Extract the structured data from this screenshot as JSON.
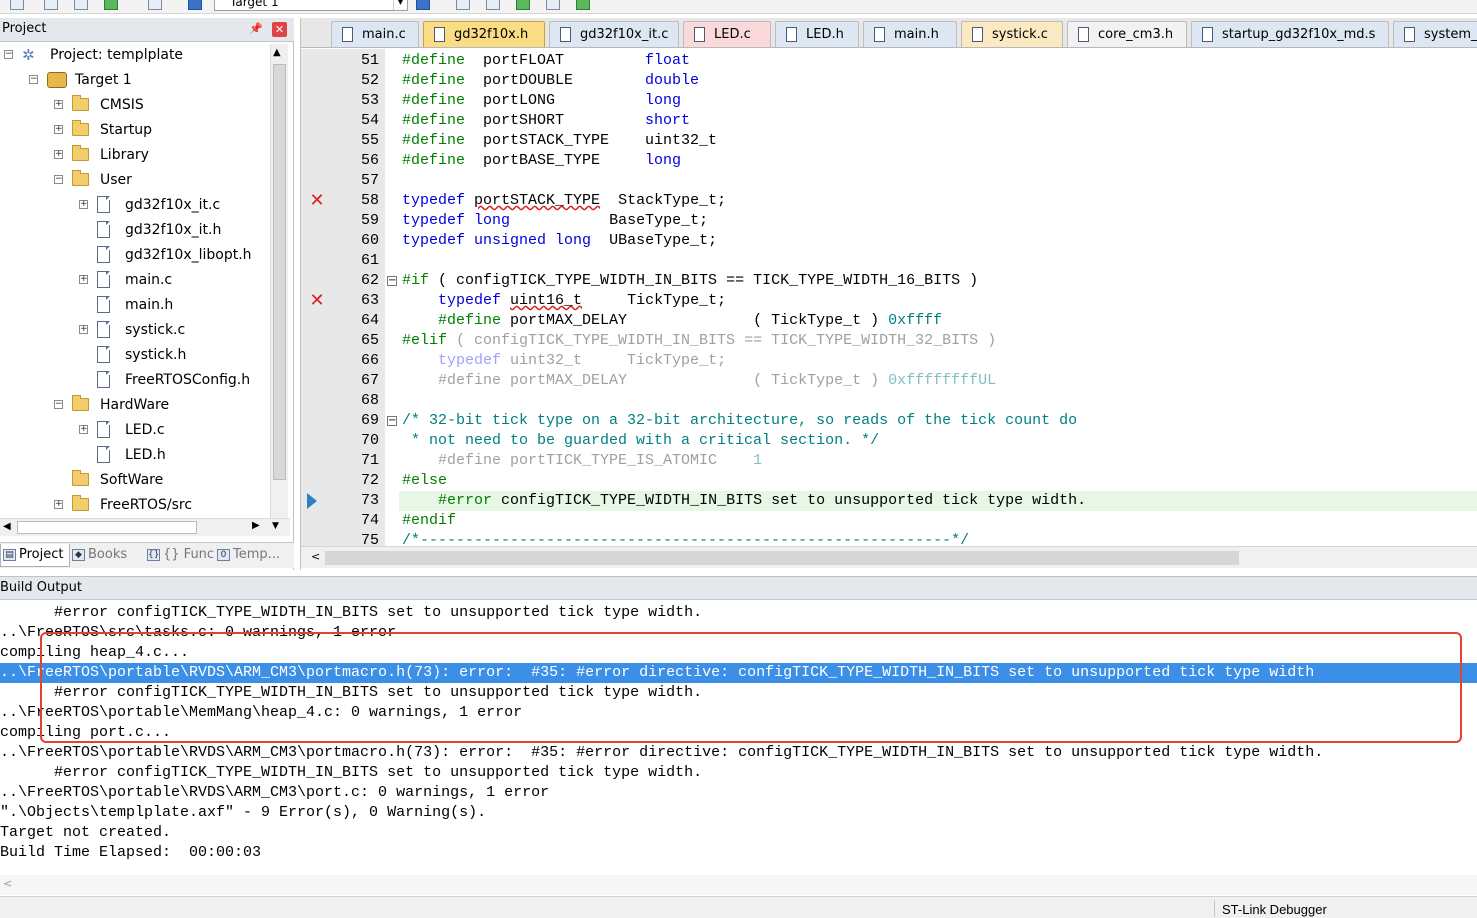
{
  "toolbar": {
    "target_value": "Target 1",
    "icons": [
      "build-icon",
      "rebuild-icon",
      "batch-build-icon",
      "translate-icon",
      "download-icon",
      "options-icon",
      "manage-icon",
      "debug-icon",
      "load-icon",
      "pack-icon"
    ]
  },
  "project_panel": {
    "title": "Project",
    "tree": [
      {
        "label": "Project: templplate",
        "kind": "project",
        "level": 0,
        "expander": "−"
      },
      {
        "label": "Target 1",
        "kind": "target",
        "level": 1,
        "expander": "−"
      },
      {
        "label": "CMSIS",
        "kind": "folder",
        "level": 2,
        "expander": "+"
      },
      {
        "label": "Startup",
        "kind": "folder",
        "level": 2,
        "expander": "+"
      },
      {
        "label": "Library",
        "kind": "folder",
        "level": 2,
        "expander": "+"
      },
      {
        "label": "User",
        "kind": "folder",
        "level": 2,
        "expander": "−"
      },
      {
        "label": "gd32f10x_it.c",
        "kind": "file",
        "level": 3,
        "expander": "+"
      },
      {
        "label": "gd32f10x_it.h",
        "kind": "file",
        "level": 3,
        "expander": ""
      },
      {
        "label": "gd32f10x_libopt.h",
        "kind": "file",
        "level": 3,
        "expander": ""
      },
      {
        "label": "main.c",
        "kind": "file",
        "level": 3,
        "expander": "+"
      },
      {
        "label": "main.h",
        "kind": "file",
        "level": 3,
        "expander": ""
      },
      {
        "label": "systick.c",
        "kind": "file",
        "level": 3,
        "expander": "+"
      },
      {
        "label": "systick.h",
        "kind": "file",
        "level": 3,
        "expander": ""
      },
      {
        "label": "FreeRTOSConfig.h",
        "kind": "file",
        "level": 3,
        "expander": ""
      },
      {
        "label": "HardWare",
        "kind": "folder",
        "level": 2,
        "expander": "−"
      },
      {
        "label": "LED.c",
        "kind": "file",
        "level": 3,
        "expander": "+"
      },
      {
        "label": "LED.h",
        "kind": "file",
        "level": 3,
        "expander": ""
      },
      {
        "label": "SoftWare",
        "kind": "folder",
        "level": 2,
        "expander": ""
      },
      {
        "label": "FreeRTOS/src",
        "kind": "folder",
        "level": 2,
        "expander": "+"
      }
    ],
    "bottom_tabs": [
      {
        "label": "Project",
        "icon": "project-icon",
        "active": true
      },
      {
        "label": "Books",
        "icon": "books-icon",
        "active": false
      },
      {
        "label": "{} Func...",
        "icon": "functions-icon",
        "active": false
      },
      {
        "label": "Temp...",
        "icon": "templates-icon",
        "active": false
      }
    ]
  },
  "editor": {
    "tabs": [
      {
        "label": "main.c",
        "style": "c"
      },
      {
        "label": "gd32f10x.h",
        "style": "active"
      },
      {
        "label": "gd32f10x_it.c",
        "style": "c"
      },
      {
        "label": "LED.c",
        "style": "red"
      },
      {
        "label": "LED.h",
        "style": "c"
      },
      {
        "label": "main.h",
        "style": "c"
      },
      {
        "label": "systick.c",
        "style": "hl"
      },
      {
        "label": "core_cm3.h",
        "style": "h"
      },
      {
        "label": "startup_gd32f10x_md.s",
        "style": "c"
      },
      {
        "label": "system_",
        "style": "c"
      }
    ],
    "lines": [
      {
        "n": "51",
        "marker": "",
        "fold": "",
        "exec": false,
        "segs": [
          [
            "pp",
            "#define"
          ],
          [
            "",
            "  portFLOAT         "
          ],
          [
            "kw",
            "float"
          ]
        ]
      },
      {
        "n": "52",
        "marker": "",
        "fold": "",
        "exec": false,
        "segs": [
          [
            "pp",
            "#define"
          ],
          [
            "",
            "  portDOUBLE        "
          ],
          [
            "kw",
            "double"
          ]
        ]
      },
      {
        "n": "53",
        "marker": "",
        "fold": "",
        "exec": false,
        "segs": [
          [
            "pp",
            "#define"
          ],
          [
            "",
            "  portLONG          "
          ],
          [
            "kw",
            "long"
          ]
        ]
      },
      {
        "n": "54",
        "marker": "",
        "fold": "",
        "exec": false,
        "segs": [
          [
            "pp",
            "#define"
          ],
          [
            "",
            "  portSHORT         "
          ],
          [
            "kw",
            "short"
          ]
        ]
      },
      {
        "n": "55",
        "marker": "",
        "fold": "",
        "exec": false,
        "segs": [
          [
            "pp",
            "#define"
          ],
          [
            "",
            "  portSTACK_TYPE    uint32_t"
          ]
        ]
      },
      {
        "n": "56",
        "marker": "",
        "fold": "",
        "exec": false,
        "segs": [
          [
            "pp",
            "#define"
          ],
          [
            "",
            "  portBASE_TYPE     "
          ],
          [
            "kw",
            "long"
          ]
        ]
      },
      {
        "n": "57",
        "marker": "",
        "fold": "",
        "exec": false,
        "segs": []
      },
      {
        "n": "58",
        "marker": "error",
        "fold": "",
        "exec": false,
        "segs": [
          [
            "kw",
            "typedef"
          ],
          [
            "",
            " "
          ],
          [
            "wavy",
            "portSTACK_TYPE"
          ],
          [
            "",
            "  StackType_t;"
          ]
        ]
      },
      {
        "n": "59",
        "marker": "",
        "fold": "",
        "exec": false,
        "segs": [
          [
            "kw",
            "typedef"
          ],
          [
            "",
            " "
          ],
          [
            "kw",
            "long"
          ],
          [
            "",
            "           BaseType_t;"
          ]
        ]
      },
      {
        "n": "60",
        "marker": "",
        "fold": "",
        "exec": false,
        "segs": [
          [
            "kw",
            "typedef"
          ],
          [
            "",
            " "
          ],
          [
            "kw",
            "unsigned long"
          ],
          [
            "",
            "  UBaseType_t;"
          ]
        ]
      },
      {
        "n": "61",
        "marker": "",
        "fold": "",
        "exec": false,
        "segs": []
      },
      {
        "n": "62",
        "marker": "",
        "fold": "−",
        "exec": false,
        "segs": [
          [
            "pp",
            "#if"
          ],
          [
            "",
            " ( configTICK_TYPE_WIDTH_IN_BITS == TICK_TYPE_WIDTH_16_BITS )"
          ]
        ]
      },
      {
        "n": "63",
        "marker": "error",
        "fold": "",
        "exec": false,
        "segs": [
          [
            "",
            "    "
          ],
          [
            "kw",
            "typedef"
          ],
          [
            "",
            " "
          ],
          [
            "wavy",
            "uint16_t"
          ],
          [
            "",
            "     TickType_t;"
          ]
        ]
      },
      {
        "n": "64",
        "marker": "",
        "fold": "",
        "exec": false,
        "segs": [
          [
            "",
            "    "
          ],
          [
            "pp",
            "#define"
          ],
          [
            "",
            " portMAX_DELAY              ( TickType_t ) "
          ],
          [
            "num",
            "0xffff"
          ]
        ]
      },
      {
        "n": "65",
        "marker": "",
        "fold": "",
        "exec": false,
        "segs": [
          [
            "pp",
            "#elif"
          ],
          [
            "gray",
            " ( configTICK_TYPE_WIDTH_IN_BITS == TICK_TYPE_WIDTH_32_BITS )"
          ]
        ]
      },
      {
        "n": "66",
        "marker": "",
        "fold": "",
        "exec": false,
        "segs": [
          [
            "",
            "    "
          ],
          [
            "gk",
            "typedef"
          ],
          [
            "gray",
            " uint32_t     TickType_t;"
          ]
        ]
      },
      {
        "n": "67",
        "marker": "",
        "fold": "",
        "exec": false,
        "segs": [
          [
            "",
            "    "
          ],
          [
            "gray",
            "#define portMAX_DELAY              ( TickType_t ) "
          ],
          [
            "gn",
            "0xffffffffUL"
          ]
        ]
      },
      {
        "n": "68",
        "marker": "",
        "fold": "",
        "exec": false,
        "segs": []
      },
      {
        "n": "69",
        "marker": "",
        "fold": "−",
        "exec": false,
        "segs": [
          [
            "cm",
            "/* 32-bit tick type on a 32-bit architecture, so reads of the tick count do"
          ]
        ]
      },
      {
        "n": "70",
        "marker": "",
        "fold": "",
        "exec": false,
        "segs": [
          [
            "cm",
            " * not need to be guarded with a critical section. */"
          ]
        ]
      },
      {
        "n": "71",
        "marker": "",
        "fold": "",
        "exec": false,
        "segs": [
          [
            "",
            "    "
          ],
          [
            "gray",
            "#define portTICK_TYPE_IS_ATOMIC    "
          ],
          [
            "gn",
            "1"
          ]
        ]
      },
      {
        "n": "72",
        "marker": "",
        "fold": "",
        "exec": false,
        "segs": [
          [
            "pp",
            "#else"
          ]
        ]
      },
      {
        "n": "73",
        "marker": "exec",
        "fold": "",
        "exec": true,
        "segs": [
          [
            "",
            "    "
          ],
          [
            "pp",
            "#error"
          ],
          [
            "",
            " configTICK_TYPE_WIDTH_IN_BITS set to unsupported tick type width."
          ]
        ]
      },
      {
        "n": "74",
        "marker": "",
        "fold": "",
        "exec": false,
        "segs": [
          [
            "pp",
            "#endif"
          ]
        ]
      },
      {
        "n": "75",
        "marker": "",
        "fold": "",
        "exec": false,
        "segs": [
          [
            "cm",
            "/*-----------------------------------------------------------*/"
          ]
        ]
      }
    ]
  },
  "build_output": {
    "title": "Build Output",
    "selected_index": 3,
    "lines": [
      "      #error configTICK_TYPE_WIDTH_IN_BITS set to unsupported tick type width.",
      "..\\FreeRTOS\\src\\tasks.c: 0 warnings, 1 error",
      "compiling heap_4.c...",
      "..\\FreeRTOS\\portable\\RVDS\\ARM_CM3\\portmacro.h(73): error:  #35: #error directive: configTICK_TYPE_WIDTH_IN_BITS set to unsupported tick type width",
      "      #error configTICK_TYPE_WIDTH_IN_BITS set to unsupported tick type width.",
      "..\\FreeRTOS\\portable\\MemMang\\heap_4.c: 0 warnings, 1 error",
      "compiling port.c...",
      "..\\FreeRTOS\\portable\\RVDS\\ARM_CM3\\portmacro.h(73): error:  #35: #error directive: configTICK_TYPE_WIDTH_IN_BITS set to unsupported tick type width.",
      "      #error configTICK_TYPE_WIDTH_IN_BITS set to unsupported tick type width.",
      "..\\FreeRTOS\\portable\\RVDS\\ARM_CM3\\port.c: 0 warnings, 1 error",
      "\".\\Objects\\templplate.axf\" - 9 Error(s), 0 Warning(s).",
      "Target not created.",
      "Build Time Elapsed:  00:00:03"
    ]
  },
  "status_bar": {
    "debugger": "ST-Link Debugger"
  },
  "colors": {
    "selection": "#3c8fe6",
    "annotation_box": "#e0442a",
    "error_marker": "#d92020",
    "active_tab": "#f9dc84"
  }
}
